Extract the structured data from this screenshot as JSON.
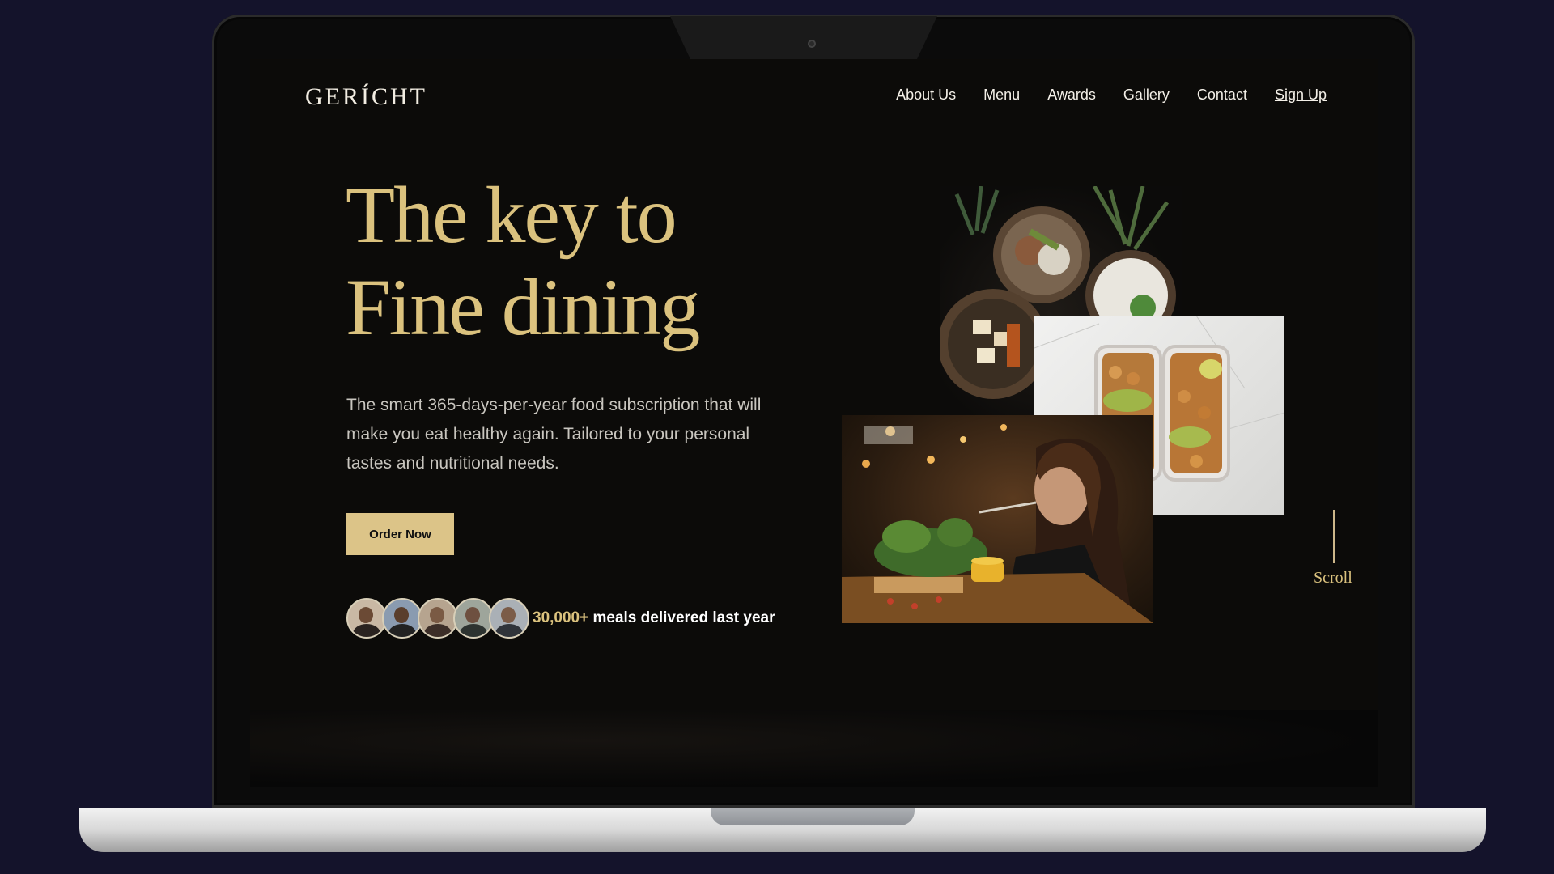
{
  "brand": {
    "logo": "GERÍCHT"
  },
  "nav": {
    "items": [
      "About Us",
      "Menu",
      "Awards",
      "Gallery",
      "Contact"
    ],
    "signup": "Sign Up"
  },
  "hero": {
    "title_line1": "The key to",
    "title_line2": "Fine dining",
    "description": "The smart 365-days-per-year food subscription that will make you eat healthy again. Tailored to your personal tastes and nutritional needs.",
    "cta": "Order Now"
  },
  "social_proof": {
    "count": "30,000+",
    "text": " meals delivered last year"
  },
  "scroll": {
    "label": "Scroll"
  },
  "colors": {
    "accent": "#dbc27e",
    "background": "#0c0b09",
    "button": "#dcc488",
    "outer_background": "#14132b"
  }
}
